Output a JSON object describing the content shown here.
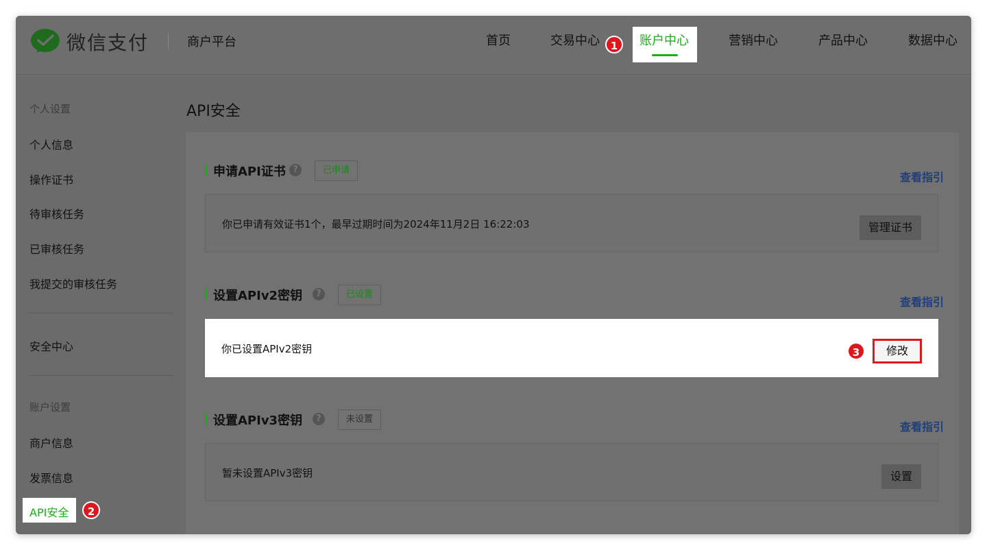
{
  "header": {
    "brand": "微信支付",
    "subtitle": "商户平台",
    "nav": [
      {
        "label": "首页"
      },
      {
        "label": "交易中心"
      },
      {
        "label": "账户中心"
      },
      {
        "label": "营销中心"
      },
      {
        "label": "产品中心"
      },
      {
        "label": "数据中心"
      }
    ]
  },
  "step_badges": [
    "1",
    "2",
    "3"
  ],
  "sidebar": {
    "group1": "个人设置",
    "items1": [
      "个人信息",
      "操作证书",
      "待审核任务",
      "已审核任务",
      "我提交的审核任务"
    ],
    "security": "安全中心",
    "group2": "账户设置",
    "items2": [
      "商户信息",
      "发票信息",
      "API安全"
    ]
  },
  "main": {
    "title": "API安全",
    "sections": [
      {
        "title": "申请API证书",
        "status": "已申请",
        "guide": "查看指引",
        "text": "你已申请有效证书1个，最早过期时间为2024年11月2日 16:22:03",
        "button": "管理证书"
      },
      {
        "title": "设置APIv2密钥",
        "status": "已设置",
        "guide": "查看指引",
        "text": "你已设置APIv2密钥",
        "button": "修改"
      },
      {
        "title": "设置APIv3密钥",
        "status": "未设置",
        "guide": "查看指引",
        "text": "暂未设置APIv3密钥",
        "button": "设置"
      }
    ]
  },
  "colors": {
    "accent": "#1aad19",
    "highlight": "#e0161e",
    "overlay": "#6b6b6b"
  }
}
